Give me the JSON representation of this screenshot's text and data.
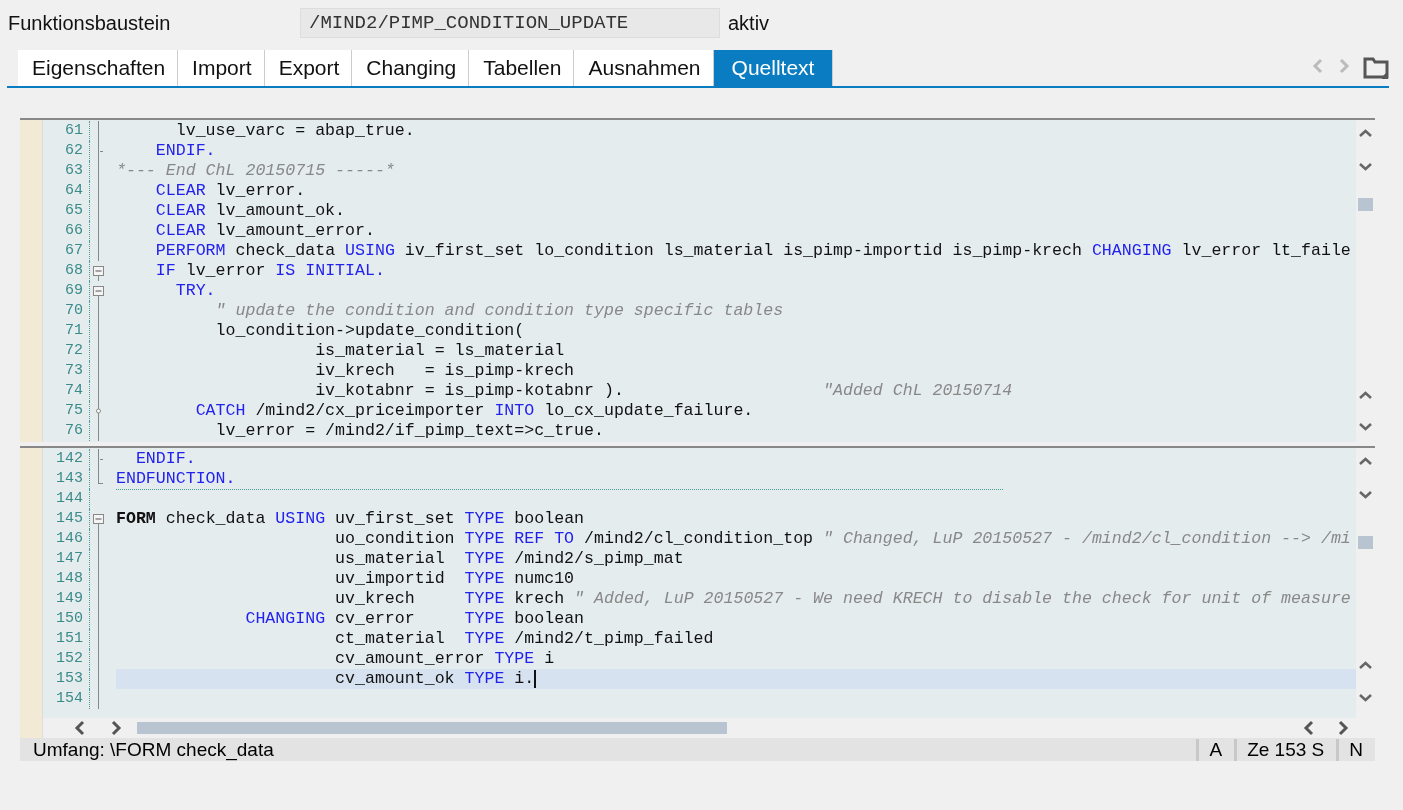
{
  "header": {
    "label": "Funktionsbaustein",
    "value": "/MIND2/PIMP_CONDITION_UPDATE",
    "status": "aktiv"
  },
  "tabs": [
    {
      "label": "Eigenschaften",
      "selected": false
    },
    {
      "label": "Import",
      "selected": false
    },
    {
      "label": "Export",
      "selected": false
    },
    {
      "label": "Changing",
      "selected": false
    },
    {
      "label": "Tabellen",
      "selected": false
    },
    {
      "label": "Ausnahmen",
      "selected": false
    },
    {
      "label": "Quelltext",
      "selected": true
    }
  ],
  "nav_buttons": [
    {
      "kind": "back",
      "disabled": true
    },
    {
      "kind": "forward",
      "disabled": true
    },
    {
      "kind": "folder",
      "disabled": false
    }
  ],
  "editor": {
    "panes": [
      {
        "lines": [
          {
            "number": "61",
            "kind": "line",
            "current": false,
            "separator": false,
            "segments": [
              {
                "kind": "text",
                "text": "      lv_use_varc = abap_true."
              }
            ]
          },
          {
            "number": "62",
            "kind": "tick",
            "current": false,
            "separator": false,
            "segments": [
              {
                "kind": "keyword",
                "text": "    ENDIF."
              }
            ]
          },
          {
            "number": "63",
            "kind": "line",
            "current": false,
            "separator": false,
            "segments": [
              {
                "kind": "comment",
                "text": "*--- End ChL 20150715 -----*"
              }
            ]
          },
          {
            "number": "64",
            "kind": "line",
            "current": false,
            "separator": false,
            "segments": [
              {
                "kind": "keyword",
                "text": "    CLEAR"
              },
              {
                "kind": "text",
                "text": " lv_error."
              }
            ]
          },
          {
            "number": "65",
            "kind": "line",
            "current": false,
            "separator": false,
            "segments": [
              {
                "kind": "keyword",
                "text": "    CLEAR"
              },
              {
                "kind": "text",
                "text": " lv_amount_ok."
              }
            ]
          },
          {
            "number": "66",
            "kind": "line",
            "current": false,
            "separator": false,
            "segments": [
              {
                "kind": "keyword",
                "text": "    CLEAR"
              },
              {
                "kind": "text",
                "text": " lv_amount_error."
              }
            ]
          },
          {
            "number": "67",
            "kind": "line",
            "current": false,
            "separator": false,
            "segments": [
              {
                "kind": "keyword",
                "text": "    PERFORM"
              },
              {
                "kind": "text",
                "text": " check_data "
              },
              {
                "kind": "keyword",
                "text": "USING"
              },
              {
                "kind": "text",
                "text": " iv_first_set lo_condition ls_material is_pimp-importid is_pimp-krech "
              },
              {
                "kind": "keyword",
                "text": "CHANGING"
              },
              {
                "kind": "text",
                "text": " lv_error lt_faile"
              }
            ]
          },
          {
            "number": "68",
            "kind": "box",
            "current": false,
            "separator": false,
            "segments": [
              {
                "kind": "keyword",
                "text": "    IF"
              },
              {
                "kind": "text",
                "text": " lv_error "
              },
              {
                "kind": "keyword",
                "text": "IS INITIAL."
              }
            ]
          },
          {
            "number": "69",
            "kind": "box",
            "current": false,
            "separator": false,
            "segments": [
              {
                "kind": "keyword",
                "text": "      TRY."
              }
            ]
          },
          {
            "number": "70",
            "kind": "line",
            "current": false,
            "separator": false,
            "segments": [
              {
                "kind": "comment",
                "text": "          \" update the condition and condition type specific tables"
              }
            ]
          },
          {
            "number": "71",
            "kind": "line",
            "current": false,
            "separator": false,
            "segments": [
              {
                "kind": "text",
                "text": "          lo_condition->update_condition("
              }
            ]
          },
          {
            "number": "72",
            "kind": "line",
            "current": false,
            "separator": false,
            "segments": [
              {
                "kind": "text",
                "text": "                    is_material = ls_material"
              }
            ]
          },
          {
            "number": "73",
            "kind": "line",
            "current": false,
            "separator": false,
            "segments": [
              {
                "kind": "text",
                "text": "                    iv_krech   = is_pimp-krech"
              }
            ]
          },
          {
            "number": "74",
            "kind": "line",
            "current": false,
            "separator": false,
            "segments": [
              {
                "kind": "text",
                "text": "                    iv_kotabnr = is_pimp-kotabnr ).                    "
              },
              {
                "kind": "comment",
                "text": "\"Added ChL 20150714"
              }
            ]
          },
          {
            "number": "75",
            "kind": "dot",
            "current": false,
            "separator": false,
            "segments": [
              {
                "kind": "keyword",
                "text": "        CATCH"
              },
              {
                "kind": "text",
                "text": " /mind2/cx_priceimporter "
              },
              {
                "kind": "keyword",
                "text": "INTO"
              },
              {
                "kind": "text",
                "text": " lo_cx_update_failure."
              }
            ]
          },
          {
            "number": "76",
            "kind": "line",
            "current": false,
            "separator": false,
            "segments": [
              {
                "kind": "text",
                "text": "          lv_error = /mind2/if_pimp_text=>c_true."
              }
            ]
          }
        ]
      },
      {
        "lines": [
          {
            "number": "142",
            "kind": "tick",
            "current": false,
            "separator": false,
            "segments": [
              {
                "kind": "keyword",
                "text": "  ENDIF."
              }
            ]
          },
          {
            "number": "143",
            "kind": "corner",
            "current": false,
            "separator": true,
            "segments": [
              {
                "kind": "keyword",
                "text": "ENDFUNCTION."
              }
            ]
          },
          {
            "number": "144",
            "kind": "none",
            "current": false,
            "separator": false
          },
          {
            "number": "145",
            "kind": "box",
            "current": false,
            "separator": false,
            "segments": [
              {
                "kind": "bold",
                "text": "FORM"
              },
              {
                "kind": "text",
                "text": " check_data "
              },
              {
                "kind": "keyword",
                "text": "USING"
              },
              {
                "kind": "text",
                "text": " uv_first_set "
              },
              {
                "kind": "keyword",
                "text": "TYPE"
              },
              {
                "kind": "text",
                "text": " boolean"
              }
            ]
          },
          {
            "number": "146",
            "kind": "line",
            "current": false,
            "separator": false,
            "segments": [
              {
                "kind": "text",
                "text": "                      uo_condition "
              },
              {
                "kind": "keyword",
                "text": "TYPE REF TO"
              },
              {
                "kind": "text",
                "text": " /mind2/cl_condition_top "
              },
              {
                "kind": "comment",
                "text": "\" Changed, LuP 20150527 - /mind2/cl_condition --> /mi"
              }
            ]
          },
          {
            "number": "147",
            "kind": "line",
            "current": false,
            "separator": false,
            "segments": [
              {
                "kind": "text",
                "text": "                      us_material  "
              },
              {
                "kind": "keyword",
                "text": "TYPE"
              },
              {
                "kind": "text",
                "text": " /mind2/s_pimp_mat"
              }
            ]
          },
          {
            "number": "148",
            "kind": "line",
            "current": false,
            "separator": false,
            "segments": [
              {
                "kind": "text",
                "text": "                      uv_importid  "
              },
              {
                "kind": "keyword",
                "text": "TYPE"
              },
              {
                "kind": "text",
                "text": " numc10"
              }
            ]
          },
          {
            "number": "149",
            "kind": "line",
            "current": false,
            "separator": false,
            "segments": [
              {
                "kind": "text",
                "text": "                      uv_krech     "
              },
              {
                "kind": "keyword",
                "text": "TYPE"
              },
              {
                "kind": "text",
                "text": " krech "
              },
              {
                "kind": "comment",
                "text": "\" Added, LuP 20150527 - We need KRECH to disable the check for unit of measure"
              }
            ]
          },
          {
            "number": "150",
            "kind": "line",
            "current": false,
            "separator": false,
            "segments": [
              {
                "kind": "keyword",
                "text": "             CHANGING"
              },
              {
                "kind": "text",
                "text": " cv_error     "
              },
              {
                "kind": "keyword",
                "text": "TYPE"
              },
              {
                "kind": "text",
                "text": " boolean"
              }
            ]
          },
          {
            "number": "151",
            "kind": "line",
            "current": false,
            "separator": false,
            "segments": [
              {
                "kind": "text",
                "text": "                      ct_material  "
              },
              {
                "kind": "keyword",
                "text": "TYPE"
              },
              {
                "kind": "text",
                "text": " /mind2/t_pimp_failed"
              }
            ]
          },
          {
            "number": "152",
            "kind": "line",
            "current": false,
            "separator": false,
            "segments": [
              {
                "kind": "text",
                "text": "                      cv_amount_error "
              },
              {
                "kind": "keyword",
                "text": "TYPE"
              },
              {
                "kind": "text",
                "text": " i"
              }
            ]
          },
          {
            "number": "153",
            "kind": "line",
            "current": true,
            "separator": false,
            "segments": [
              {
                "kind": "text",
                "text": "                      cv_amount_ok "
              },
              {
                "kind": "keyword",
                "text": "TYPE"
              },
              {
                "kind": "text",
                "text": " i."
              }
            ]
          },
          {
            "number": "154",
            "kind": "line",
            "current": false,
            "separator": false
          }
        ]
      }
    ]
  },
  "status_bar": {
    "scope": "Umfang: \\FORM check_data",
    "fields": [
      "A",
      "Ze 153 S",
      "N"
    ]
  }
}
